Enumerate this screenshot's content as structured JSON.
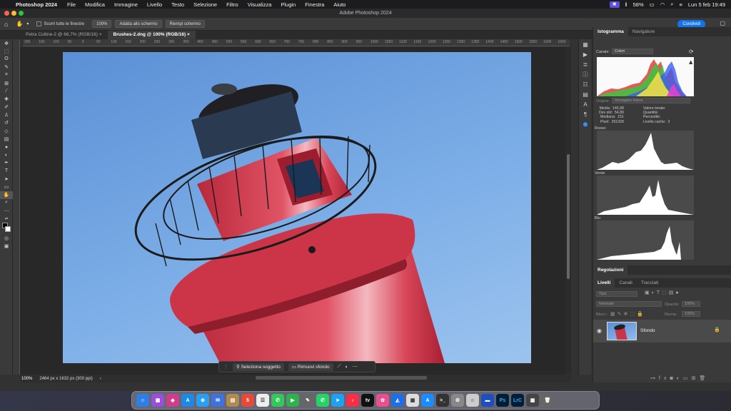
{
  "menubar": {
    "app_name": "Photoshop 2024",
    "items": [
      "File",
      "Modifica",
      "Immagine",
      "Livello",
      "Testo",
      "Selezione",
      "Filtro",
      "Visualizza",
      "Plugin",
      "Finestra",
      "Aiuto"
    ],
    "battery": "58%",
    "datetime": "Lun 5 feb  19:49"
  },
  "window": {
    "title": "Adobe Photoshop 2024"
  },
  "options": {
    "scroll_all": "Scorri tutte le finestre",
    "zoom_btn": "100%",
    "fit_btn": "Adatta allo schermo",
    "fill_btn": "Riempi schermo",
    "share": "Condividi"
  },
  "tabs": [
    {
      "label": "Petra Colline-2 @ 66,7% (RGB/16)"
    },
    {
      "label": "Brushes-2.dng @ 100% (RGB/16)"
    }
  ],
  "ruler": [
    "200",
    "150",
    "100",
    "50",
    "0",
    "50",
    "100",
    "150",
    "200",
    "250",
    "300",
    "350",
    "400",
    "450",
    "500",
    "550",
    "600",
    "650",
    "700",
    "750",
    "800",
    "850",
    "900",
    "950",
    "1000",
    "1050",
    "1100",
    "1150",
    "1200",
    "1250",
    "1300",
    "1350",
    "1400",
    "1450",
    "1500",
    "1550",
    "1600",
    "1650"
  ],
  "context": {
    "select_subject": "Seleziona soggetto",
    "remove_bg": "Rimuovi sfondo"
  },
  "status": {
    "zoom": "100%",
    "doc_info": "2464 px x 1632 px (300 ppi)"
  },
  "histogram": {
    "tab_active": "Istogramma",
    "tab_other": "Navigatore",
    "channel_label": "Canale:",
    "channel_value": "Colori",
    "source_label": "Origine:",
    "source_value": "Immagine intera",
    "stats_left": "Media:  145,98\nDev std:  54,89\nMediana:  151\nPixel:  251328",
    "stats_right": "Valore tonale:\nQuantità:\nPercentile:\nLivello cache:  3",
    "red": "Rosso",
    "green": "Verde",
    "blue": "Blu"
  },
  "adjustments": {
    "title": "Regolazioni"
  },
  "layers": {
    "tabs": [
      "Livelli",
      "Canali",
      "Tracciati"
    ],
    "search": "Tipo",
    "blend": "Normale",
    "opacity_label": "Opacità:",
    "opacity": "100%",
    "lock_label": "Blocc.:",
    "fill_label": "Riemp.:",
    "fill": "100%",
    "layer_name": "Sfondo"
  },
  "colors": {
    "accent": "#1473e6",
    "sky": "#6ea2e0",
    "tower": "#d23c4e"
  }
}
